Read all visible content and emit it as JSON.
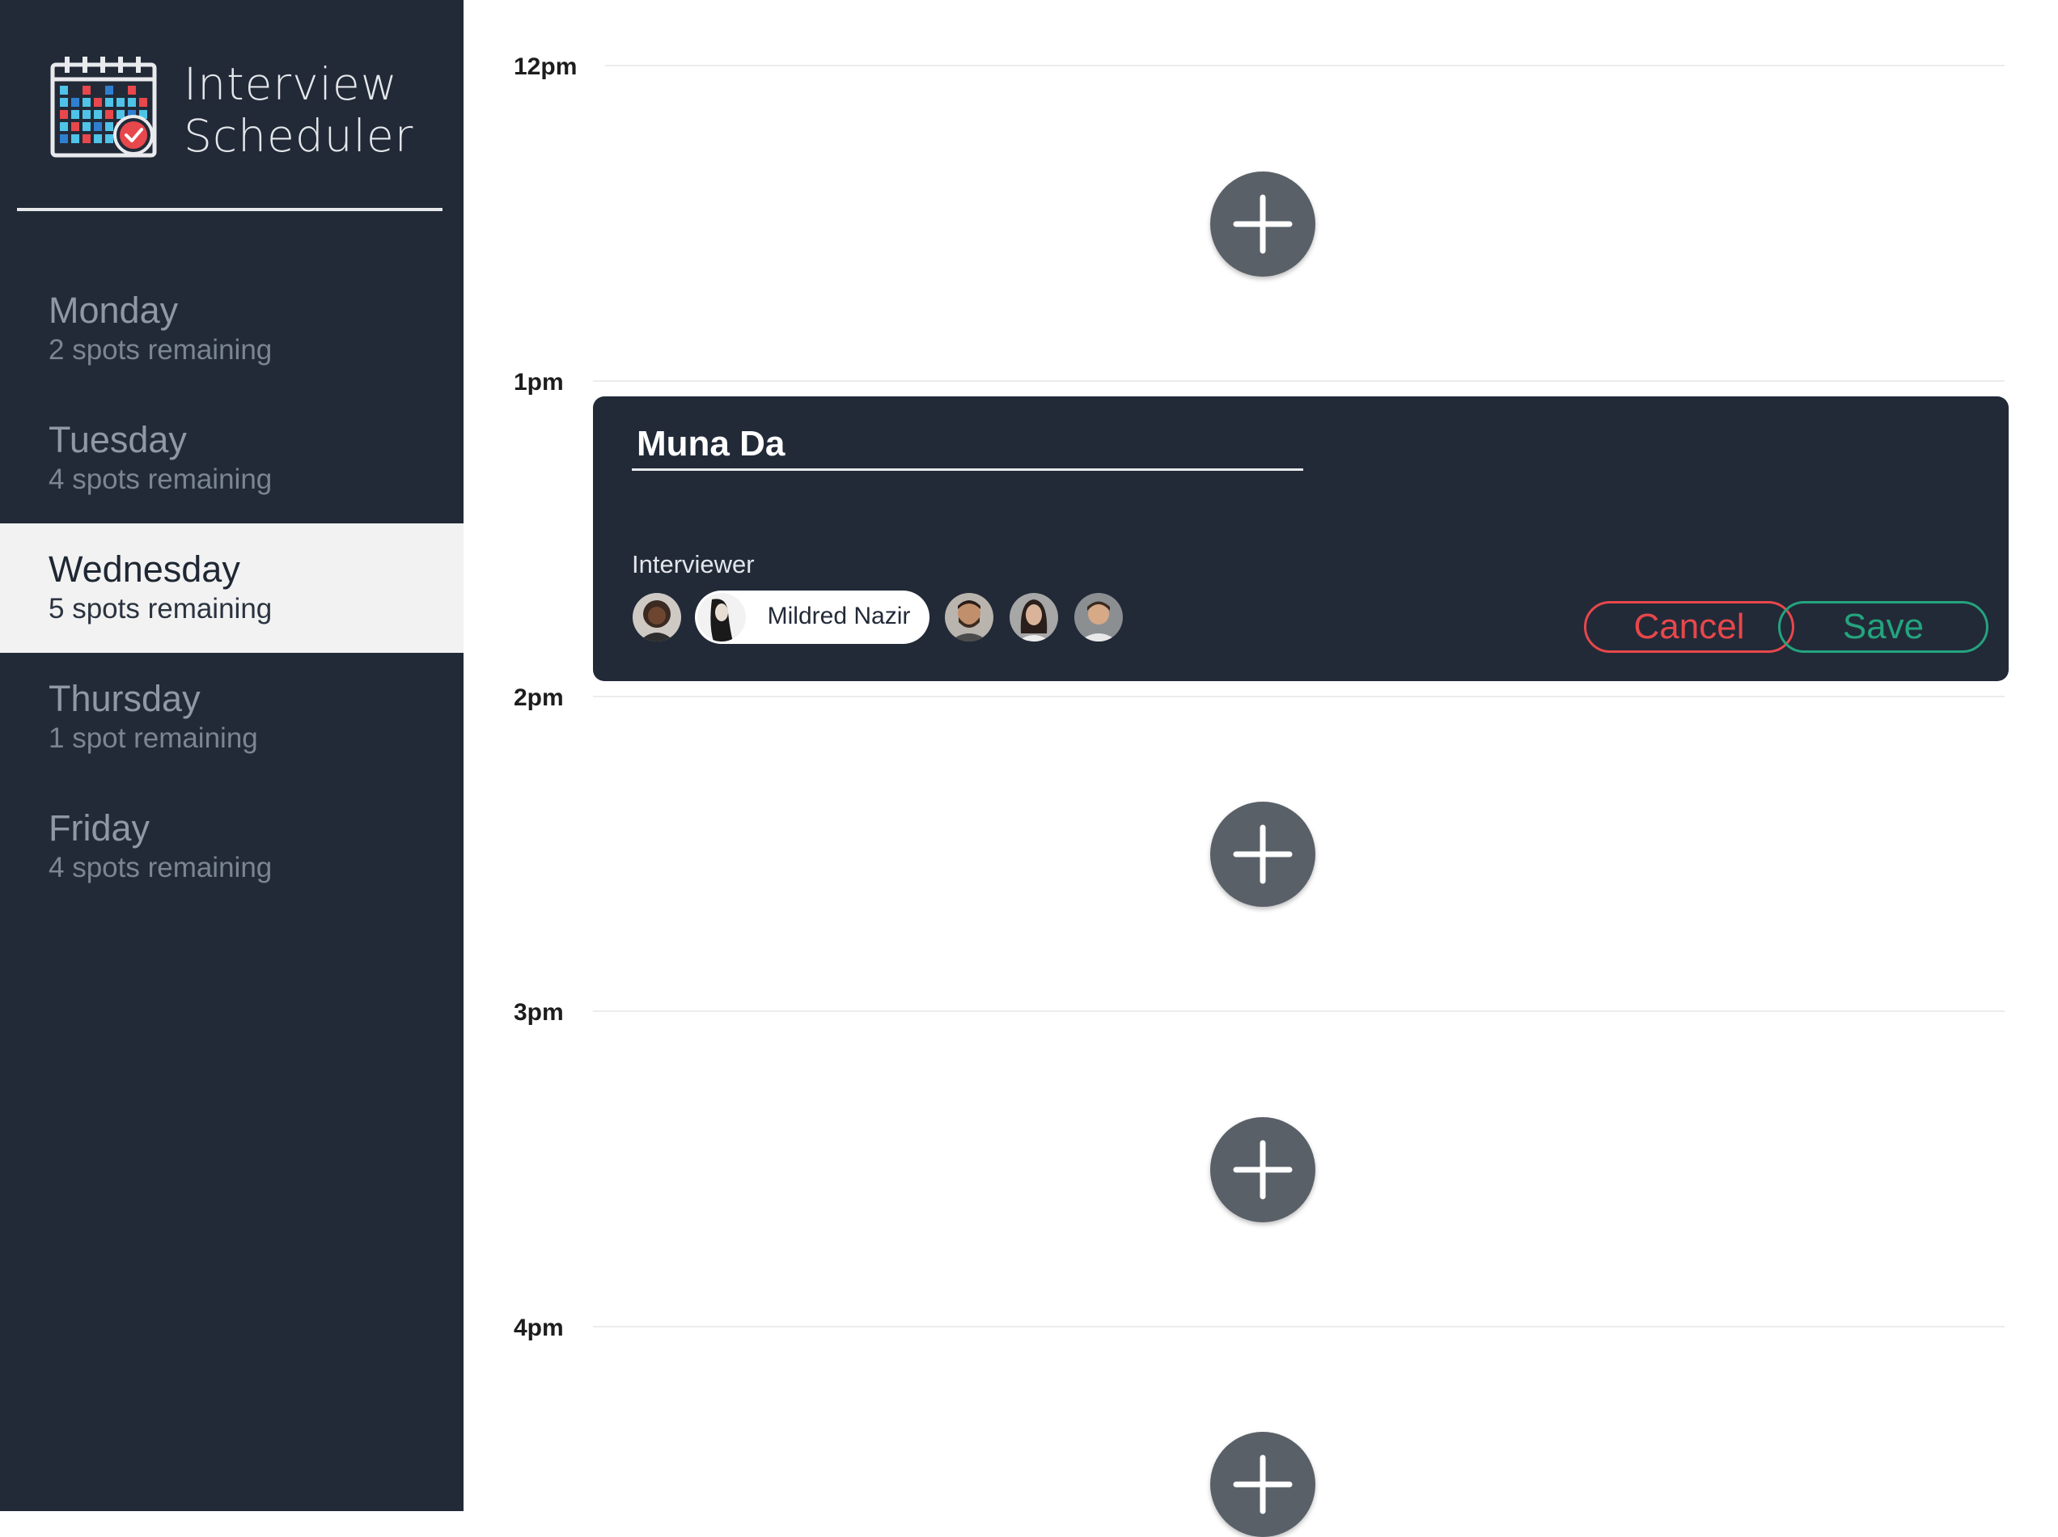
{
  "brand": {
    "title_line1": "Interview",
    "title_line2": "Scheduler",
    "logo_icon": "calendar-check-icon"
  },
  "days": [
    {
      "name": "Monday",
      "spots": "2 spots remaining",
      "selected": false
    },
    {
      "name": "Tuesday",
      "spots": "4 spots remaining",
      "selected": false
    },
    {
      "name": "Wednesday",
      "spots": "5 spots remaining",
      "selected": true
    },
    {
      "name": "Thursday",
      "spots": "1 spot remaining",
      "selected": false
    },
    {
      "name": "Friday",
      "spots": "4 spots remaining",
      "selected": false
    }
  ],
  "schedule": {
    "times": [
      "12pm",
      "1pm",
      "2pm",
      "3pm",
      "4pm"
    ],
    "add_icon": "plus-icon"
  },
  "form": {
    "student_name": "Muna Da",
    "interviewer_label": "Interviewer",
    "selected_interviewer": "Mildred Nazir",
    "cancel_label": "Cancel",
    "save_label": "Save"
  },
  "colors": {
    "sidebar_bg": "#222a38",
    "selected_day_bg": "#f2f2f2",
    "cancel": "#e8474b",
    "save": "#24a47e",
    "add_button": "#5a6068"
  }
}
